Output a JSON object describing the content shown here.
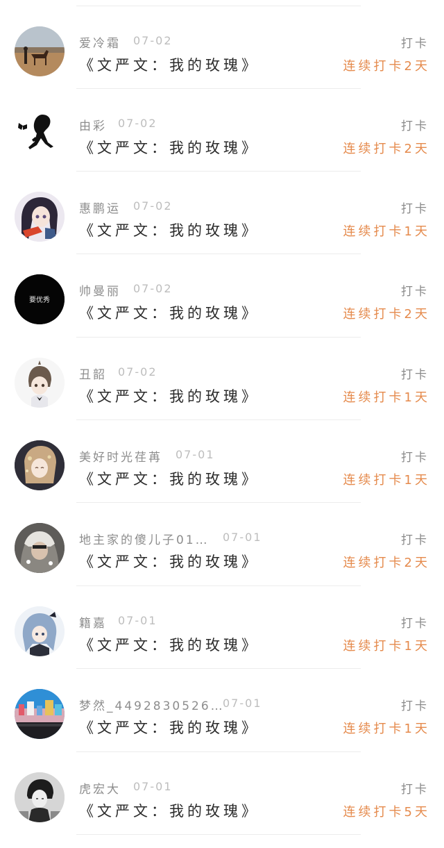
{
  "colors": {
    "accent": "#e58a4c",
    "name_text": "#8d8d8d",
    "date_text": "#bdbdbd",
    "title_text": "#2a2a2a",
    "action_text": "#8a8a8a",
    "divider": "#ececec"
  },
  "entries": [
    {
      "name": "爱冷霜",
      "date": "07-02",
      "title": "《文严文：我的玫瑰》",
      "action": "打卡",
      "streak": "连续打卡2天",
      "avatar_icon": "desert-horse-avatar-icon"
    },
    {
      "name": "由彩",
      "date": "07-02",
      "title": "《文严文：我的玫瑰》",
      "action": "打卡",
      "streak": "连续打卡2天",
      "avatar_icon": "butterfly-silhouette-avatar-icon"
    },
    {
      "name": "惠鹏运",
      "date": "07-02",
      "title": "《文严文：我的玫瑰》",
      "action": "打卡",
      "streak": "连续打卡1天",
      "avatar_icon": "anime-girl-avatar-icon"
    },
    {
      "name": "帅曼丽",
      "date": "07-02",
      "title": "《文严文：我的玫瑰》",
      "action": "打卡",
      "streak": "连续打卡2天",
      "avatar_icon": "black-text-avatar-icon",
      "avatar_text": "要优秀"
    },
    {
      "name": "丑韶",
      "date": "07-02",
      "title": "《文严文：我的玫瑰》",
      "action": "打卡",
      "streak": "连续打卡1天",
      "avatar_icon": "anime-boy-avatar-icon"
    },
    {
      "name": "美好时光荏苒",
      "date": "07-01",
      "title": "《文严文：我的玫瑰》",
      "action": "打卡",
      "streak": "连续打卡1天",
      "avatar_icon": "illustrated-girl-avatar-icon"
    },
    {
      "name": "地主家的傻儿子01…",
      "date": "07-01",
      "title": "《文严文：我的玫瑰》",
      "action": "打卡",
      "streak": "连续打卡2天",
      "avatar_icon": "hooded-person-avatar-icon"
    },
    {
      "name": "籍嘉",
      "date": "07-01",
      "title": "《文严文：我的玫瑰》",
      "action": "打卡",
      "streak": "连续打卡1天",
      "avatar_icon": "blue-hair-girl-avatar-icon"
    },
    {
      "name": "梦然_4492830526…",
      "date": "07-01",
      "title": "《文严文：我的玫瑰》",
      "action": "打卡",
      "streak": "连续打卡1天",
      "avatar_icon": "city-photo-avatar-icon"
    },
    {
      "name": "虎宏大",
      "date": "07-01",
      "title": "《文严文：我的玫瑰》",
      "action": "打卡",
      "streak": "连续打卡5天",
      "avatar_icon": "vintage-portrait-avatar-icon"
    }
  ]
}
